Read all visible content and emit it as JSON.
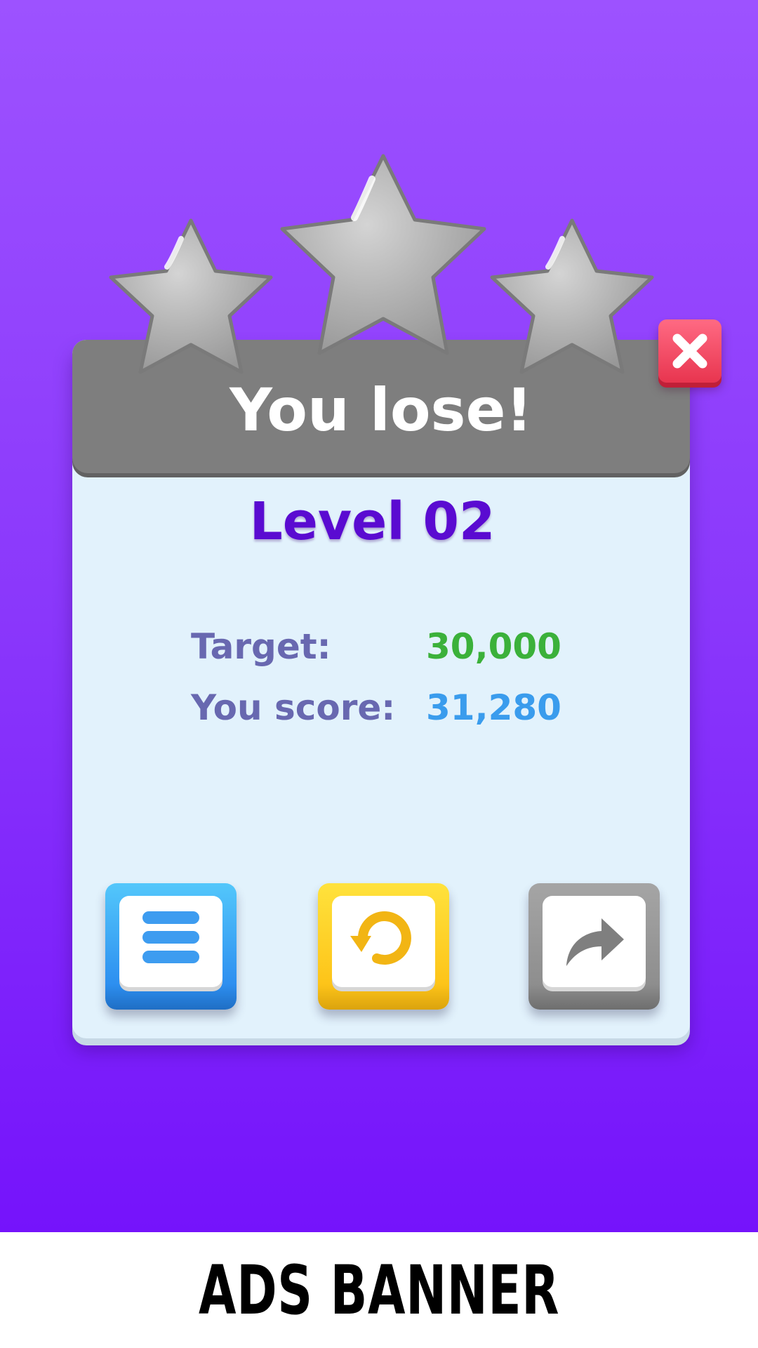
{
  "dialog": {
    "title": "You lose!",
    "level": "Level 02",
    "stars_earned": 0,
    "stars_total": 3
  },
  "stats": {
    "target_label": "Target:",
    "target_value": "30,000",
    "score_label": "You score:",
    "score_value": "31,280"
  },
  "buttons": {
    "close_icon": "close-icon",
    "menu_icon": "menu-icon",
    "retry_icon": "retry-icon",
    "share_icon": "share-icon"
  },
  "ads": {
    "banner_text": "ADS BANNER"
  },
  "colors": {
    "background_top": "#9d52ff",
    "background_bottom": "#7513fb",
    "header_gray": "#7e7e7e",
    "panel_bg": "#e2f2fc",
    "level_text": "#5a0bd1",
    "label_text": "#6868b0",
    "target_green": "#3bb13a",
    "score_blue": "#3a9ced",
    "close_red": "#e8354f",
    "menu_blue": "#2d8ff0",
    "retry_yellow": "#fdc419",
    "share_gray": "#8e8e8e"
  }
}
